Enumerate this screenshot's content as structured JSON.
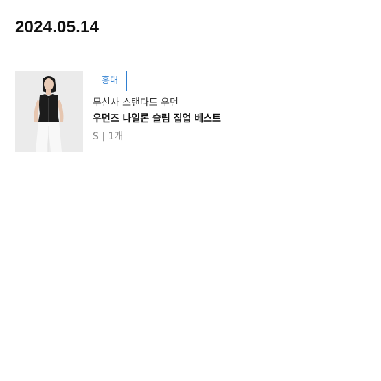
{
  "header": {
    "date": "2024.05.14"
  },
  "order": {
    "store_badge": "홍대",
    "brand": "무신사 스탠다드 우먼",
    "product_name": "우먼즈 나일론 슬림 집업 베스트",
    "option": "S | 1개",
    "thumbnail_icon": "product-photo-icon"
  },
  "colors": {
    "accent": "#2f7fd1",
    "text_primary": "#111111",
    "text_secondary": "#888888"
  }
}
